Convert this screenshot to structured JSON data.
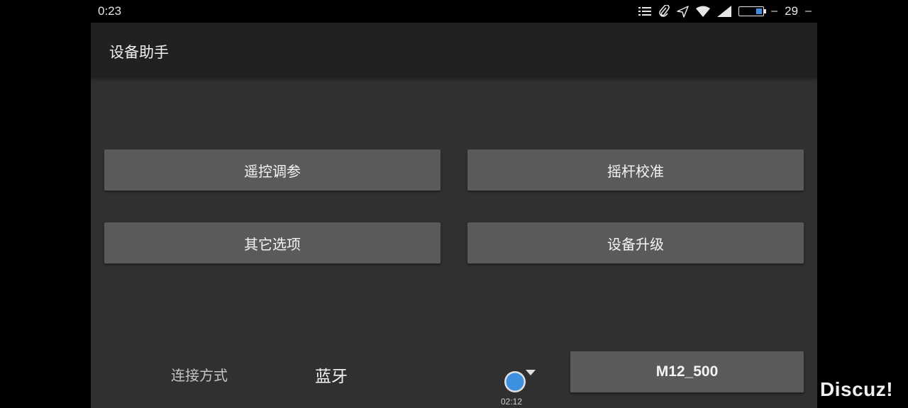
{
  "status_bar": {
    "time": "0:23",
    "battery_dash": "–",
    "battery_level": "29",
    "battery_fraction": 0.29,
    "battery_color": "#3d8fe0",
    "trailing_dash": "–",
    "icons": [
      "list-icon",
      "paperclip-icon",
      "send-icon",
      "wifi-icon",
      "signal-icon",
      "battery-icon"
    ]
  },
  "app": {
    "title": "设备助手",
    "menu": {
      "remote_tuning": "遥控调参",
      "stick_calibration": "摇杆校准",
      "other_options": "其它选项",
      "device_upgrade": "设备升级"
    },
    "connection": {
      "label": "连接方式",
      "value": "蓝牙"
    },
    "indicator": {
      "time": "02:12",
      "color": "#3d8fe0"
    },
    "device_name": "M12_500"
  },
  "watermark": "Discuz!"
}
